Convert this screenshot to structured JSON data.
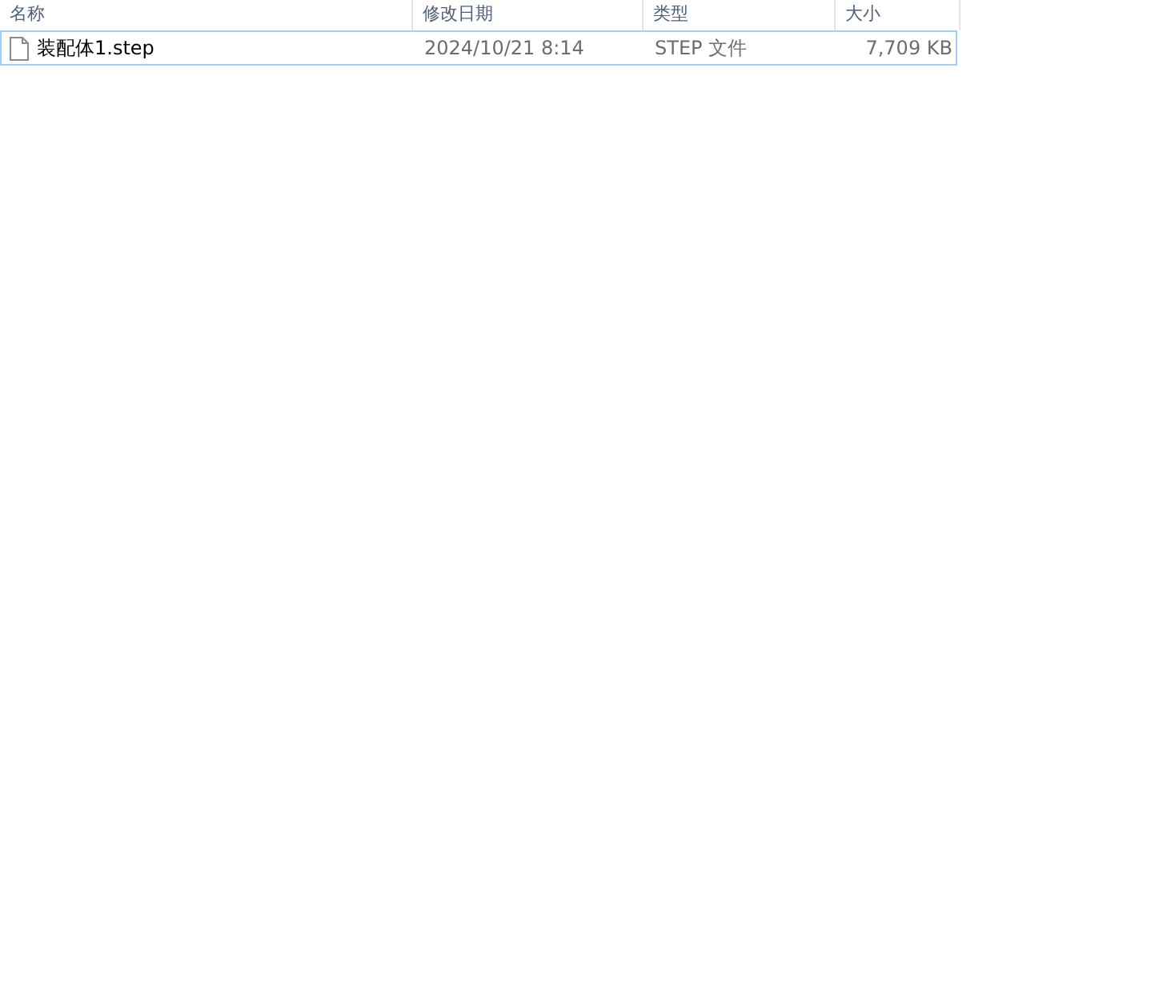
{
  "columns": [
    {
      "label": "名称"
    },
    {
      "label": "修改日期"
    },
    {
      "label": "类型"
    },
    {
      "label": "大小"
    }
  ],
  "files": [
    {
      "name": "装配体1.step",
      "modified": "2024/10/21 8:14",
      "type": "STEP 文件",
      "size": "7,709 KB",
      "selected": true
    }
  ]
}
